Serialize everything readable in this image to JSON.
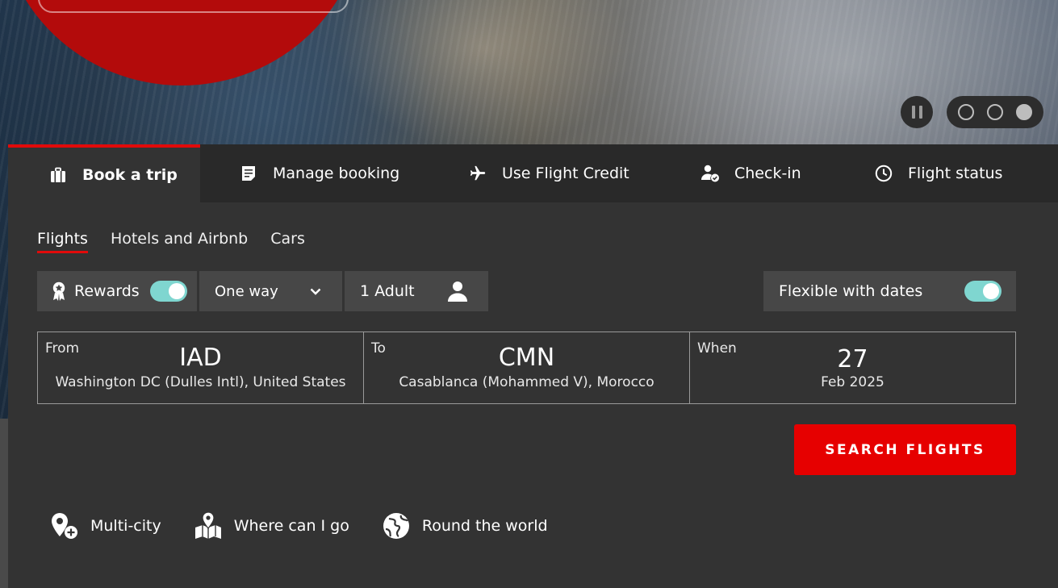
{
  "hero": {
    "carousel_pause_icon": "pause-icon",
    "carousel_slides": 3,
    "carousel_active_slide": 3
  },
  "colors": {
    "accent_red": "#e60000",
    "toggle_on": "#7fd6d0",
    "panel_bg": "#333333"
  },
  "tabs": [
    {
      "label": "Book a trip",
      "icon": "suitcase-icon",
      "active": true
    },
    {
      "label": "Manage booking",
      "icon": "document-icon",
      "active": false
    },
    {
      "label": "Use Flight Credit",
      "icon": "airplane-icon",
      "active": false
    },
    {
      "label": "Check-in",
      "icon": "person-check-icon",
      "active": false
    },
    {
      "label": "Flight status",
      "icon": "clock-icon",
      "active": false
    }
  ],
  "subtabs": [
    {
      "label": "Flights",
      "active": true
    },
    {
      "label": "Hotels and Airbnb",
      "active": false
    },
    {
      "label": "Cars",
      "active": false
    }
  ],
  "options": {
    "rewards_label": "Rewards",
    "rewards_on": true,
    "trip_type": "One way",
    "passengers": "1 Adult",
    "flexible_label": "Flexible with dates",
    "flexible_on": true
  },
  "route": {
    "from_label": "From",
    "from_code": "IAD",
    "from_city": "Washington DC (Dulles Intl), United States",
    "to_label": "To",
    "to_code": "CMN",
    "to_city": "Casablanca (Mohammed V), Morocco",
    "when_label": "When",
    "when_day": "27",
    "when_month": "Feb 2025"
  },
  "search_label": "SEARCH FLIGHTS",
  "links": [
    {
      "label": "Multi-city",
      "icon": "pin-plus-icon"
    },
    {
      "label": "Where can I go",
      "icon": "map-pin-icon"
    },
    {
      "label": "Round the world",
      "icon": "globe-icon"
    }
  ]
}
